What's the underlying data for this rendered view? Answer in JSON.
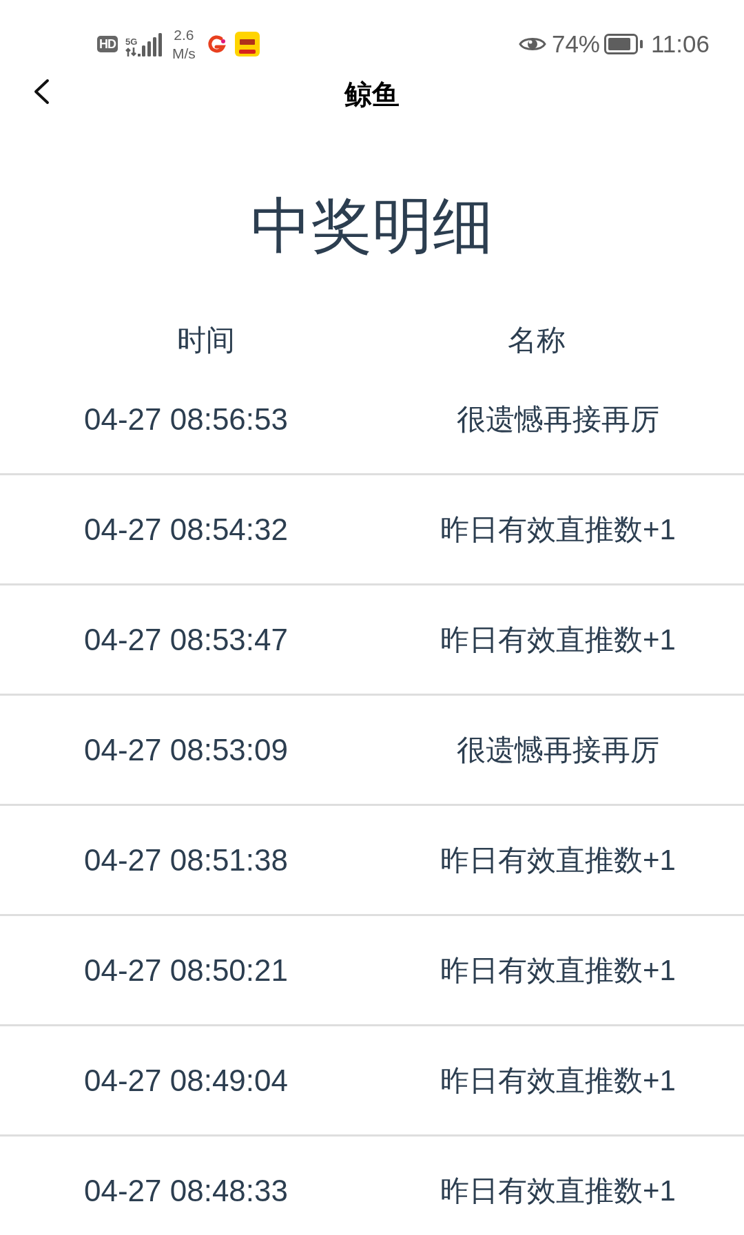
{
  "status_bar": {
    "hd": "HD",
    "network": "5G",
    "speed_value": "2.6",
    "speed_unit": "M/s",
    "battery_percent": "74%",
    "time": "11:06"
  },
  "nav": {
    "title": "鲸鱼"
  },
  "heading": "中奖明细",
  "table": {
    "columns": [
      "时间",
      "名称"
    ],
    "rows": [
      {
        "time": "04-27 08:56:53",
        "name": "很遗憾再接再厉"
      },
      {
        "time": "04-27 08:54:32",
        "name": "昨日有效直推数+1"
      },
      {
        "time": "04-27 08:53:47",
        "name": "昨日有效直推数+1"
      },
      {
        "time": "04-27 08:53:09",
        "name": "很遗憾再接再厉"
      },
      {
        "time": "04-27 08:51:38",
        "name": "昨日有效直推数+1"
      },
      {
        "time": "04-27 08:50:21",
        "name": "昨日有效直推数+1"
      },
      {
        "time": "04-27 08:49:04",
        "name": "昨日有效直推数+1"
      },
      {
        "time": "04-27 08:48:33",
        "name": "昨日有效直推数+1"
      }
    ]
  }
}
